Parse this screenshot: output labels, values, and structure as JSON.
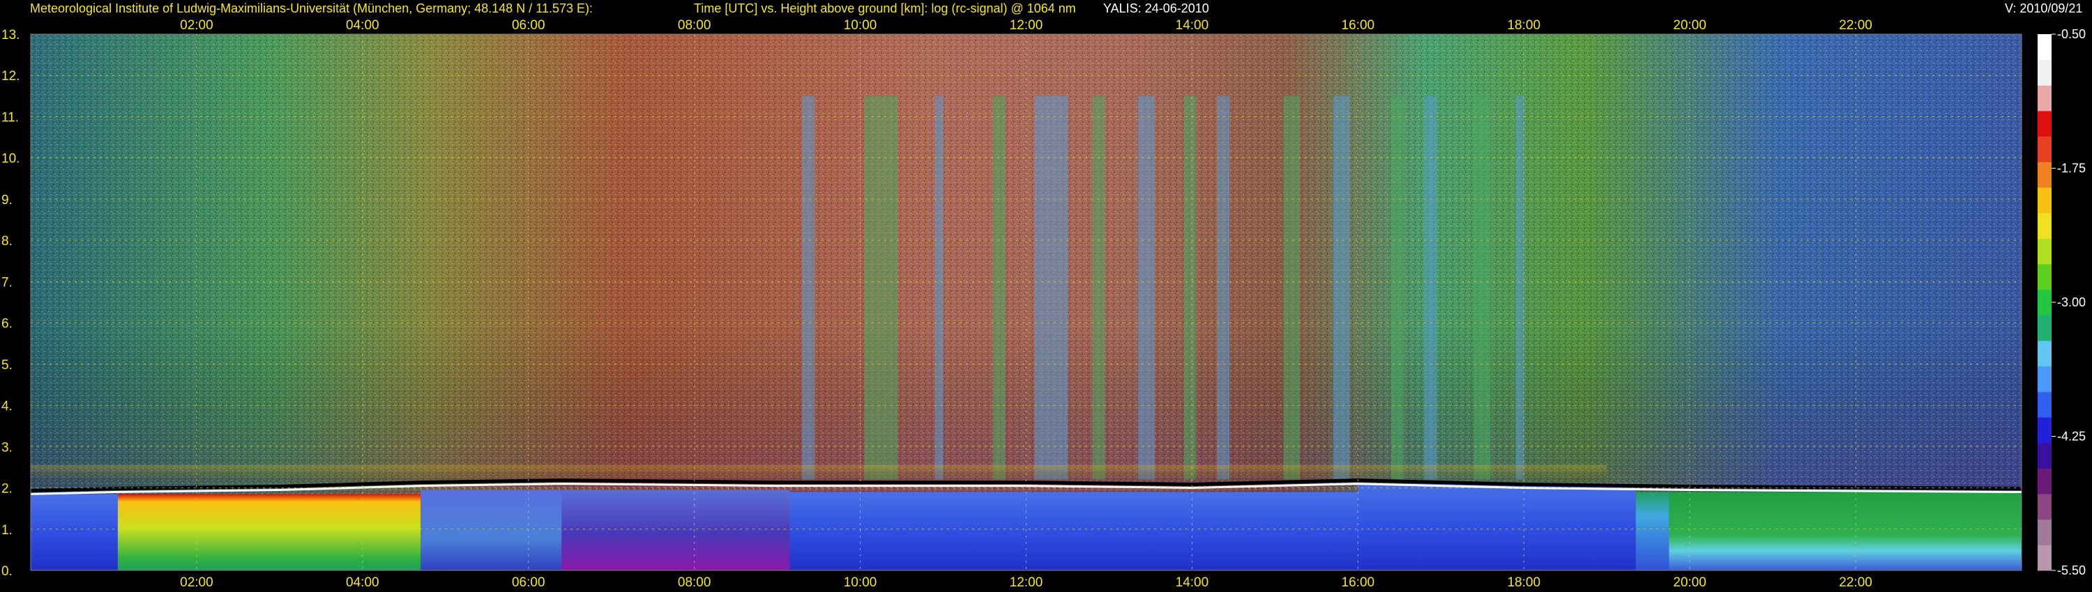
{
  "header": {
    "institute": "Meteorological Institute of Ludwig-Maximilians-Universität (München, Germany; 48.148 N / 11.573 E):",
    "axes_desc": "Time [UTC] vs. Height above ground [km]: log (rc-signal) @ 1064 nm",
    "instrument_date": "YALIS: 24-06-2010",
    "version": "V: 2010/09/21"
  },
  "colors": {
    "label_yellow": "#f5e62a",
    "grid_yellow": "#d8d020",
    "background": "#000000"
  },
  "chart_data": {
    "type": "heatmap",
    "title": "Time [UTC] vs. Height above ground [km]: log (rc-signal) @ 1064 nm",
    "xlabel": "Time [UTC]",
    "ylabel": "Height above ground [km]",
    "x_unit": "hours UTC",
    "xlim": [
      0.0,
      24.0
    ],
    "ylim": [
      0,
      13
    ],
    "x_ticks": [
      2,
      4,
      6,
      8,
      10,
      12,
      14,
      16,
      18,
      20,
      22
    ],
    "x_tick_labels": [
      "02:00",
      "04:00",
      "06:00",
      "08:00",
      "10:00",
      "12:00",
      "14:00",
      "16:00",
      "18:00",
      "20:00",
      "22:00"
    ],
    "y_ticks": [
      0,
      1,
      2,
      3,
      4,
      5,
      6,
      7,
      8,
      9,
      10,
      11,
      12,
      13
    ],
    "y_tick_labels": [
      "0.",
      "1.",
      "2.",
      "3.",
      "4.",
      "5.",
      "6.",
      "7.",
      "8.",
      "9.",
      "10.",
      "11.",
      "12.",
      "13."
    ],
    "grid": true,
    "colorbar": {
      "range": [
        -5.5,
        -0.5
      ],
      "ticks": [
        -0.5,
        -1.75,
        -3.0,
        -4.25,
        -5.5
      ],
      "tick_labels": [
        "-0.50",
        "-1.75",
        "-3.00",
        "-4.25",
        "-5.50"
      ],
      "colors": [
        "#b898b0",
        "#a07898",
        "#8c4880",
        "#6a1a78",
        "#3a10a0",
        "#2020d8",
        "#3060f0",
        "#4a98f8",
        "#60c8f0",
        "#20b070",
        "#20c840",
        "#60d020",
        "#b0e020",
        "#f0e020",
        "#f8c010",
        "#f08020",
        "#e84020",
        "#e01010",
        "#e8a8a8",
        "#f0f0f0",
        "#ffffff"
      ]
    },
    "boundary_layer_top_km": [
      {
        "t": 0.0,
        "h": 1.85
      },
      {
        "t": 1.0,
        "h": 1.9
      },
      {
        "t": 3.0,
        "h": 1.95
      },
      {
        "t": 4.7,
        "h": 2.05
      },
      {
        "t": 6.4,
        "h": 2.1
      },
      {
        "t": 9.0,
        "h": 2.05
      },
      {
        "t": 10.0,
        "h": 2.05
      },
      {
        "t": 12.0,
        "h": 2.05
      },
      {
        "t": 14.0,
        "h": 2.0
      },
      {
        "t": 16.0,
        "h": 2.1
      },
      {
        "t": 18.0,
        "h": 2.0
      },
      {
        "t": 20.0,
        "h": 1.95
      },
      {
        "t": 24.0,
        "h": 1.9
      }
    ]
  }
}
